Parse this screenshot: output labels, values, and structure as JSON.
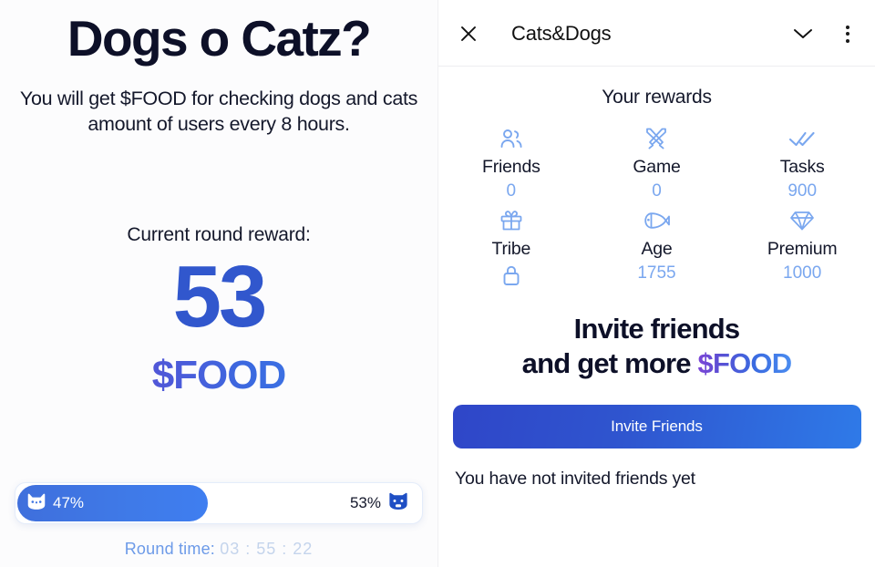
{
  "left": {
    "title": "Dogs o Catz?",
    "subtitle": "You will get $FOOD for checking dogs and cats amount of users every 8 hours.",
    "round_reward_label": "Current round reward:",
    "round_reward_amount": "53",
    "round_reward_currency": "$FOOD",
    "progress": {
      "cat_percent": "47%",
      "dog_percent": "53%",
      "cat_icon": "cat-icon",
      "dog_icon": "dog-icon",
      "fill_ratio": 0.47
    },
    "round_time_label": "Round time:",
    "round_time_value": "03 : 55 : 22"
  },
  "right": {
    "header": {
      "close_icon": "close-icon",
      "title": "Cats&Dogs",
      "chevron_icon": "chevron-down-icon",
      "menu_icon": "more-vertical-icon"
    },
    "rewards_title": "Your rewards",
    "rewards": [
      {
        "icon": "people-icon",
        "label": "Friends",
        "value": "0",
        "locked": false
      },
      {
        "icon": "swords-icon",
        "label": "Game",
        "value": "0",
        "locked": false
      },
      {
        "icon": "double-check-icon",
        "label": "Tasks",
        "value": "900",
        "locked": false
      },
      {
        "icon": "gift-icon",
        "label": "Tribe",
        "value": "",
        "locked": true
      },
      {
        "icon": "fish-icon",
        "label": "Age",
        "value": "1755",
        "locked": false
      },
      {
        "icon": "diamond-icon",
        "label": "Premium",
        "value": "1000",
        "locked": false
      }
    ],
    "invite_heading_line1": "Invite friends",
    "invite_heading_line2_prefix": "and get more ",
    "invite_heading_line2_token": "$FOOD",
    "invite_button_label": "Invite Friends",
    "invite_status": "You have not invited friends yet"
  },
  "colors": {
    "brand_blue": "#3157cd",
    "accent_light_blue": "#7aa7ef",
    "food_purple": "#7b45d6",
    "text_dark": "#14182b"
  }
}
